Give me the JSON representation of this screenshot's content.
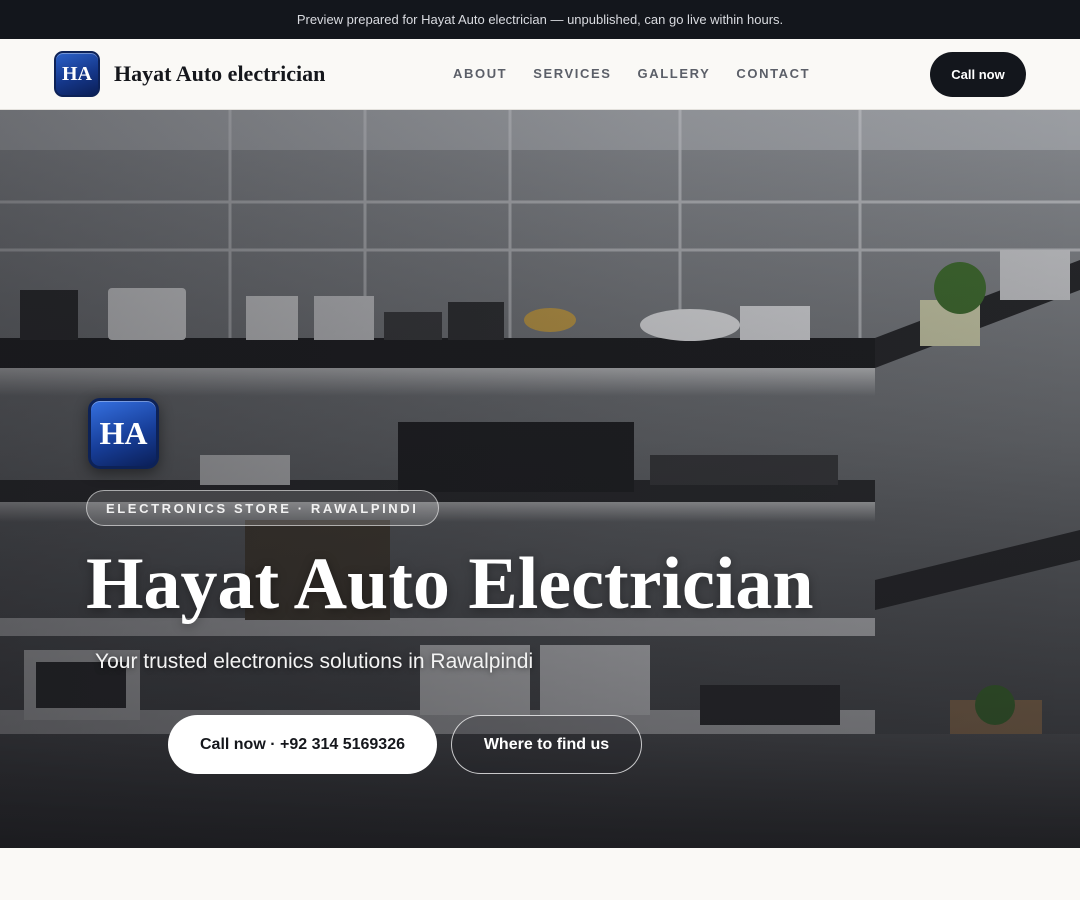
{
  "banner": {
    "text": "Preview prepared for Hayat Auto electrician — unpublished, can go live within hours."
  },
  "header": {
    "logo_initials": "HA",
    "brand_name": "Hayat Auto electrician",
    "nav": [
      {
        "label": "ABOUT"
      },
      {
        "label": "SERVICES"
      },
      {
        "label": "GALLERY"
      },
      {
        "label": "CONTACT"
      }
    ],
    "cta_label": "Call now"
  },
  "hero": {
    "logo_initials": "HA",
    "tagline": "ELECTRONICS STORE · RAWALPINDI",
    "title": "Hayat Auto Electrician",
    "subtitle": "Your trusted electronics solutions in Rawalpindi",
    "primary_button": "Call now · +92 314 5169326",
    "secondary_button": "Where to find us"
  },
  "colors": {
    "dark": "#13161c",
    "page_bg": "#faf9f6",
    "logo_blue": "#1e4fb4"
  }
}
